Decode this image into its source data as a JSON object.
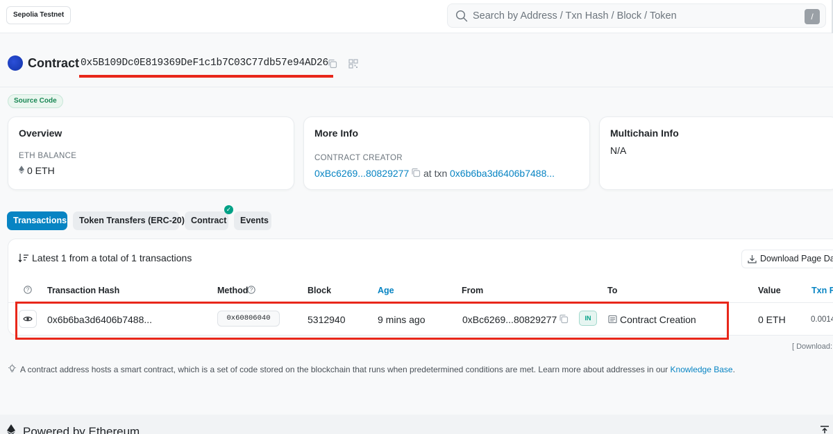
{
  "header": {
    "network": "Sepolia Testnet",
    "search_placeholder": "Search by Address / Txn Hash / Block / Token",
    "search_shortcut": "/"
  },
  "contract": {
    "title": "Contract",
    "address": "0x5B109Dc0E819369DeF1c1b7C03C77db57e94AD26",
    "source_badge": "Source Code"
  },
  "cards": {
    "overview": {
      "title": "Overview",
      "balance_label": "ETH BALANCE",
      "balance_value": "0 ETH"
    },
    "more_info": {
      "title": "More Info",
      "creator_label": "CONTRACT CREATOR",
      "creator_address": "0xBc6269...80829277",
      "at_txn_text": "at txn",
      "creation_txn": "0x6b6ba3d6406b7488..."
    },
    "multichain": {
      "title": "Multichain Info",
      "value": "N/A"
    }
  },
  "tabs": [
    {
      "label": "Transactions",
      "active": true
    },
    {
      "label": "Token Transfers (ERC-20)",
      "active": false
    },
    {
      "label": "Contract",
      "active": false
    },
    {
      "label": "Events",
      "active": false
    }
  ],
  "table": {
    "summary": "Latest 1 from a total of 1 transactions",
    "download_label": "Download Page Data",
    "headers": {
      "hash": "Transaction Hash",
      "method": "Method",
      "block": "Block",
      "age": "Age",
      "from": "From",
      "to": "To",
      "value": "Value",
      "fee": "Txn Fee"
    },
    "rows": [
      {
        "hash": "0x6b6ba3d6406b7488...",
        "method": "0x60806040",
        "block": "5312940",
        "age": "9 mins ago",
        "from": "0xBc6269...80829277",
        "direction": "IN",
        "to": "Contract Creation",
        "value": "0 ETH",
        "fee": "0.0014"
      }
    ],
    "download_note": "[ Download: "
  },
  "info_text_prefix": "A contract address hosts a smart contract, which is a set of code stored on the blockchain that runs when predetermined conditions are met. Learn more about addresses in our ",
  "info_link": "Knowledge Base",
  "info_text_suffix": ".",
  "footer": {
    "text": "Powered by Ethereum"
  },
  "colors": {
    "link": "#0784c3",
    "active_tab": "#0784c3",
    "annotation_red": "#e8271a",
    "verified_green": "#00a186"
  }
}
